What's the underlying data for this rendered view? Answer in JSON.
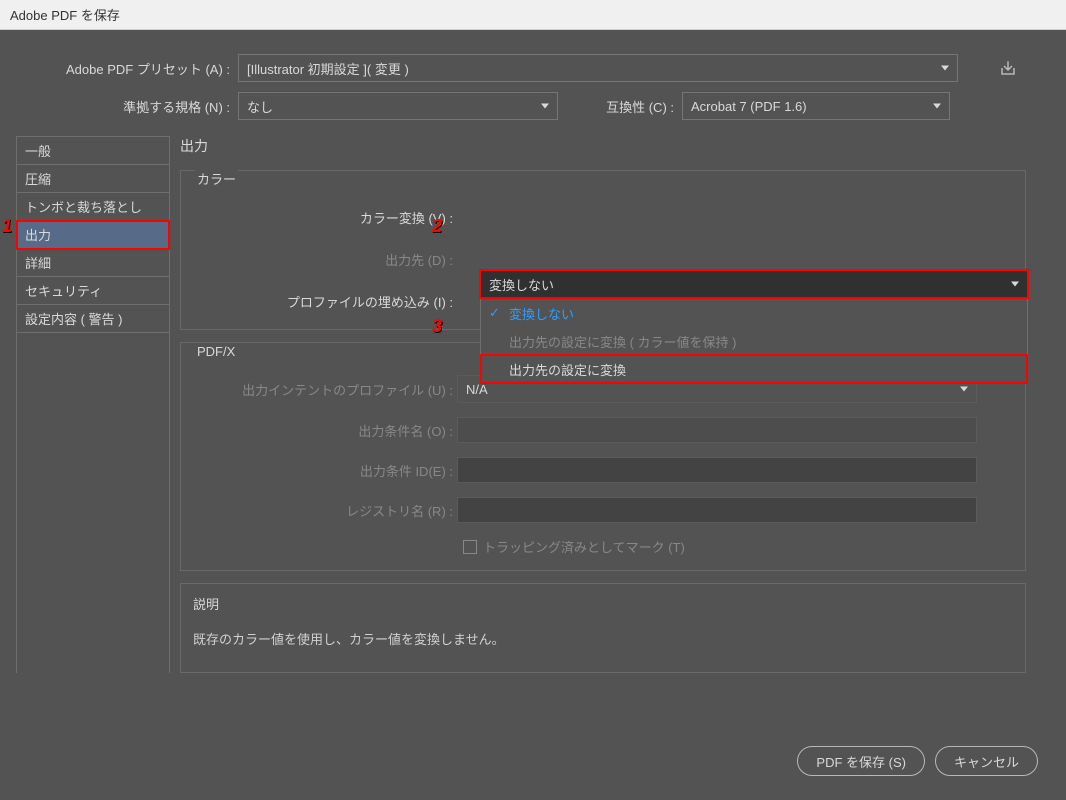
{
  "window": {
    "title": "Adobe PDF を保存"
  },
  "header": {
    "preset_label": "Adobe PDF プリセット (A) :",
    "preset_value": "[Illustrator 初期設定 ]( 変更 )",
    "standard_label": "準拠する規格 (N) :",
    "standard_value": "なし",
    "compat_label": "互換性 (C) :",
    "compat_value": "Acrobat 7 (PDF 1.6)"
  },
  "sidebar": {
    "items": [
      "一般",
      "圧縮",
      "トンボと裁ち落とし",
      "出力",
      "詳細",
      "セキュリティ",
      "設定内容 ( 警告 )"
    ],
    "selected_index": 3
  },
  "panel": {
    "title": "出力",
    "color": {
      "legend": "カラー",
      "conversion_label": "カラー変換 (V) :",
      "conversion_value": "変換しない",
      "conversion_options": [
        {
          "label": "変換しない",
          "selected": true,
          "disabled": false
        },
        {
          "label": "出力先の設定に変換 ( カラー値を保持 )",
          "selected": false,
          "disabled": true
        },
        {
          "label": "出力先の設定に変換",
          "selected": false,
          "disabled": false
        }
      ],
      "destination_label": "出力先 (D) :",
      "profile_embed_label": "プロファイルの埋め込み (I) :"
    },
    "pdfx": {
      "legend": "PDF/X",
      "intent_profile_label": "出力インテントのプロファイル (U) :",
      "intent_profile_value": "N/A",
      "condition_name_label": "出力条件名 (O) :",
      "condition_id_label": "出力条件 ID(E) :",
      "registry_label": "レジストリ名 (R) :",
      "trapping_label": "トラッピング済みとしてマーク (T)"
    },
    "description": {
      "legend": "説明",
      "text": "既存のカラー値を使用し、カラー値を変換しません。"
    }
  },
  "footer": {
    "save_label": "PDF を保存 (S)",
    "cancel_label": "キャンセル"
  },
  "markers": {
    "m1": "1",
    "m2": "2",
    "m3": "3"
  }
}
